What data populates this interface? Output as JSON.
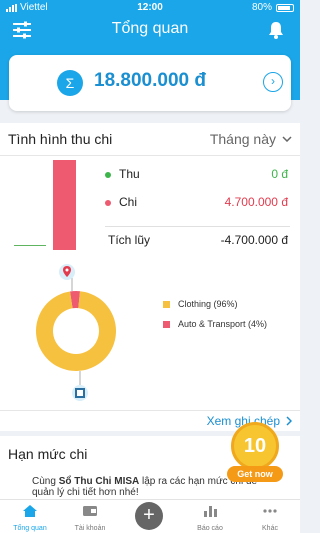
{
  "status_bar": {
    "carrier": "Viettel",
    "time": "12:00",
    "battery": "80%"
  },
  "header": {
    "title": "Tổng quan"
  },
  "total": {
    "amount": "18.800.000 đ"
  },
  "overview": {
    "title": "Tình hình thu chi",
    "period": "Tháng này",
    "income_label": "Thu",
    "income_value": "0 đ",
    "expense_label": "Chi",
    "expense_value": "4.700.000 đ",
    "accum_label": "Tích lũy",
    "accum_value": "-4.700.000 đ",
    "income_color": "#3cb54a",
    "expense_color": "#ee5a6f"
  },
  "chart_data": {
    "type": "pie",
    "categories": [
      "Clothing",
      "Auto & Transport"
    ],
    "values": [
      96,
      4
    ],
    "labels": [
      "Clothing (96%)",
      "Auto & Transport (4%)"
    ],
    "colors": [
      "#f7c140",
      "#ee5a6f"
    ]
  },
  "view_history": "Xem ghi chép",
  "limits": {
    "title": "Hạn mức chi",
    "promo_prefix": "Cùng ",
    "promo_brand": "Sổ Thu Chi MISA",
    "promo_suffix": " lập ra các hạn mức chi để quản lý chi tiết hơn nhé!"
  },
  "badge": {
    "number": "10",
    "button": "Get now"
  },
  "tabs": [
    {
      "label": "Tổng quan",
      "icon": "home-icon"
    },
    {
      "label": "Tài khoản",
      "icon": "wallet-icon"
    },
    {
      "label": "",
      "icon": "plus-icon"
    },
    {
      "label": "Báo cáo",
      "icon": "bar-chart-icon"
    },
    {
      "label": "Khác",
      "icon": "more-icon"
    }
  ]
}
